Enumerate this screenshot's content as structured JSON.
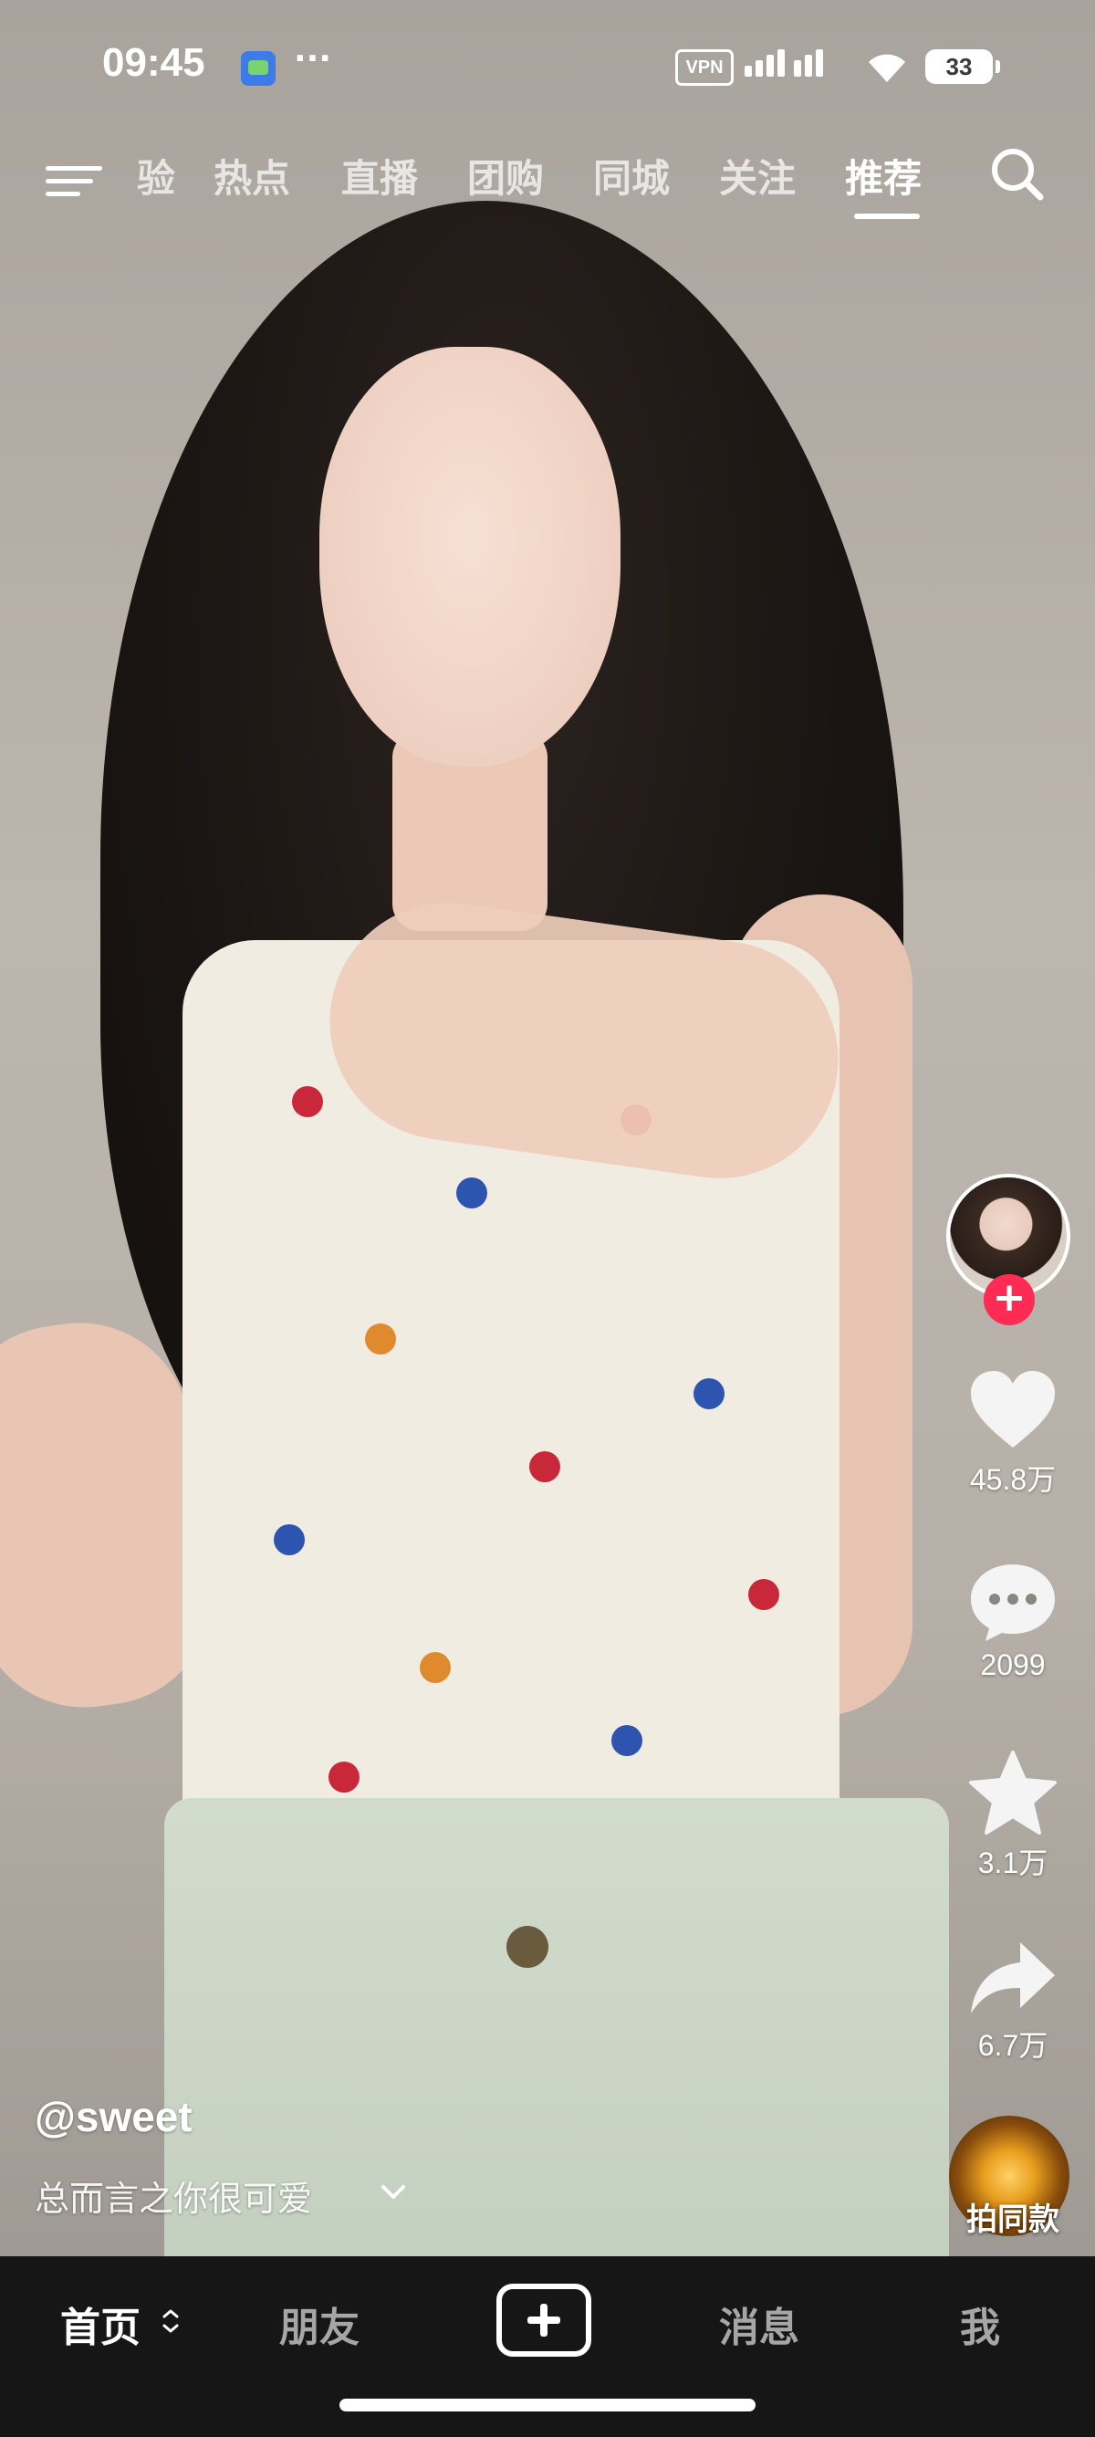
{
  "status_bar": {
    "time": "09:45",
    "more": "···",
    "vpn": "VPN",
    "battery": "33"
  },
  "top_nav": {
    "tabs": [
      {
        "label": "验",
        "active": false
      },
      {
        "label": "热点",
        "active": false
      },
      {
        "label": "直播",
        "active": false
      },
      {
        "label": "团购",
        "active": false
      },
      {
        "label": "同城",
        "active": false
      },
      {
        "label": "关注",
        "active": false
      },
      {
        "label": "推荐",
        "active": true
      }
    ]
  },
  "actions": {
    "likes": "45.8万",
    "comments": "2099",
    "favorites": "3.1万",
    "shares": "6.7万",
    "follow": "+",
    "music_label": "拍同款"
  },
  "video": {
    "author": "@sweet",
    "caption": "总而言之你很可爱"
  },
  "bottom_nav": {
    "home": "首页",
    "friends": "朋友",
    "messages": "消息",
    "me": "我"
  },
  "colors": {
    "accent_red": "#fe2c55",
    "nav_bg": "#161616"
  }
}
